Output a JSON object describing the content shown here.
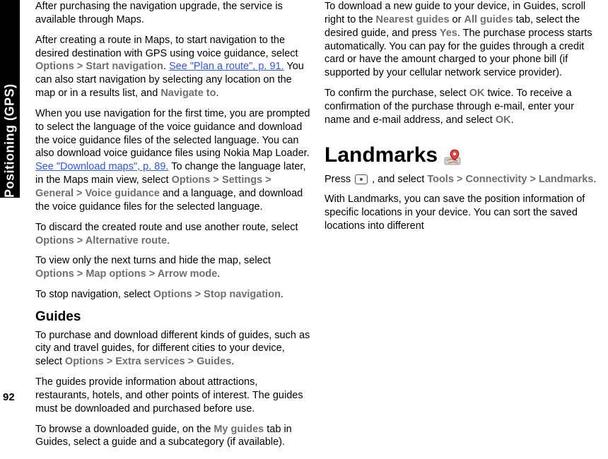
{
  "sidebar": {
    "label": "Positioning (GPS)"
  },
  "page_number": "92",
  "p1": {
    "a": "After purchasing the navigation upgrade, the service is available through Maps."
  },
  "p2": {
    "a": "After creating a route in Maps, to start navigation to the desired destination with GPS using voice guidance, select ",
    "opt1": "Options",
    "gt": " > ",
    "opt2": "Start navigation",
    "b": ". ",
    "link": "See \"Plan a route\", p. 91.",
    "c": " You can also start navigation by selecting any location on the map or in a results list, and ",
    "opt3": "Navigate to",
    "d": "."
  },
  "p3": {
    "a": "When you use navigation for the first time, you are prompted to select the language of the voice guidance and download the voice guidance files of the selected language. You can also download voice guidance files using Nokia Map Loader. ",
    "link": "See \"Download maps\", p. 89.",
    "b": " To change the language later, in the Maps main view, select ",
    "opt1": "Options",
    "gt": " > ",
    "opt2": "Settings",
    "opt3": "General",
    "opt4": "Voice guidance",
    "c": " and a language, and download the voice guidance files for the selected language."
  },
  "p4": {
    "a": "To discard the created route and use another route, select ",
    "opt1": "Options",
    "gt": " > ",
    "opt2": "Alternative route",
    "b": "."
  },
  "p5": {
    "a": "To view only the next turns and hide the map, select ",
    "opt1": "Options",
    "gt": " > ",
    "opt2": "Map options",
    "opt3": "Arrow mode",
    "b": "."
  },
  "p6": {
    "a": "To stop navigation, select ",
    "opt1": "Options",
    "gt": " > ",
    "opt2": "Stop navigation",
    "b": "."
  },
  "guides_heading": "Guides",
  "p7": {
    "a": "To purchase and download different kinds of guides, such as city and travel guides, for different cities to your device, select ",
    "opt1": "Options",
    "gt": " > ",
    "opt2": "Extra services",
    "opt3": "Guides",
    "b": "."
  },
  "p8": {
    "a": "The guides provide information about attractions, restaurants, hotels, and other points of interest. The guides must be downloaded and purchased before use."
  },
  "p9": {
    "a": "To browse a downloaded guide, on the ",
    "opt1": "My guides",
    "b": " tab in Guides, select a guide and a subcategory (if available)."
  },
  "p10": {
    "a": "To download a new guide to your device, in Guides, scroll right to the ",
    "opt1": "Nearest guides",
    "b": " or ",
    "opt2": "All guides",
    "c": " tab, select the desired guide, and press ",
    "opt3": "Yes",
    "d": ". The purchase process starts automatically. You can pay for the guides through a credit card or have the amount charged to your phone bill (if supported by your cellular network service provider)."
  },
  "p11": {
    "a": "To confirm the purchase, select ",
    "opt1": "OK",
    "b": " twice. To receive a confirmation of the purchase through e-mail, enter your name and e-mail address, and select ",
    "opt2": "OK",
    "c": "."
  },
  "landmarks_heading": "Landmarks",
  "p12": {
    "a": "Press ",
    "b": " , and select ",
    "opt1": "Tools",
    "gt": " > ",
    "opt2": "Connectivity",
    "opt3": "Landmarks",
    "c": "."
  },
  "p13": {
    "a": "With Landmarks, you can save the position information of specific locations in your device. You can sort the saved locations into different"
  }
}
